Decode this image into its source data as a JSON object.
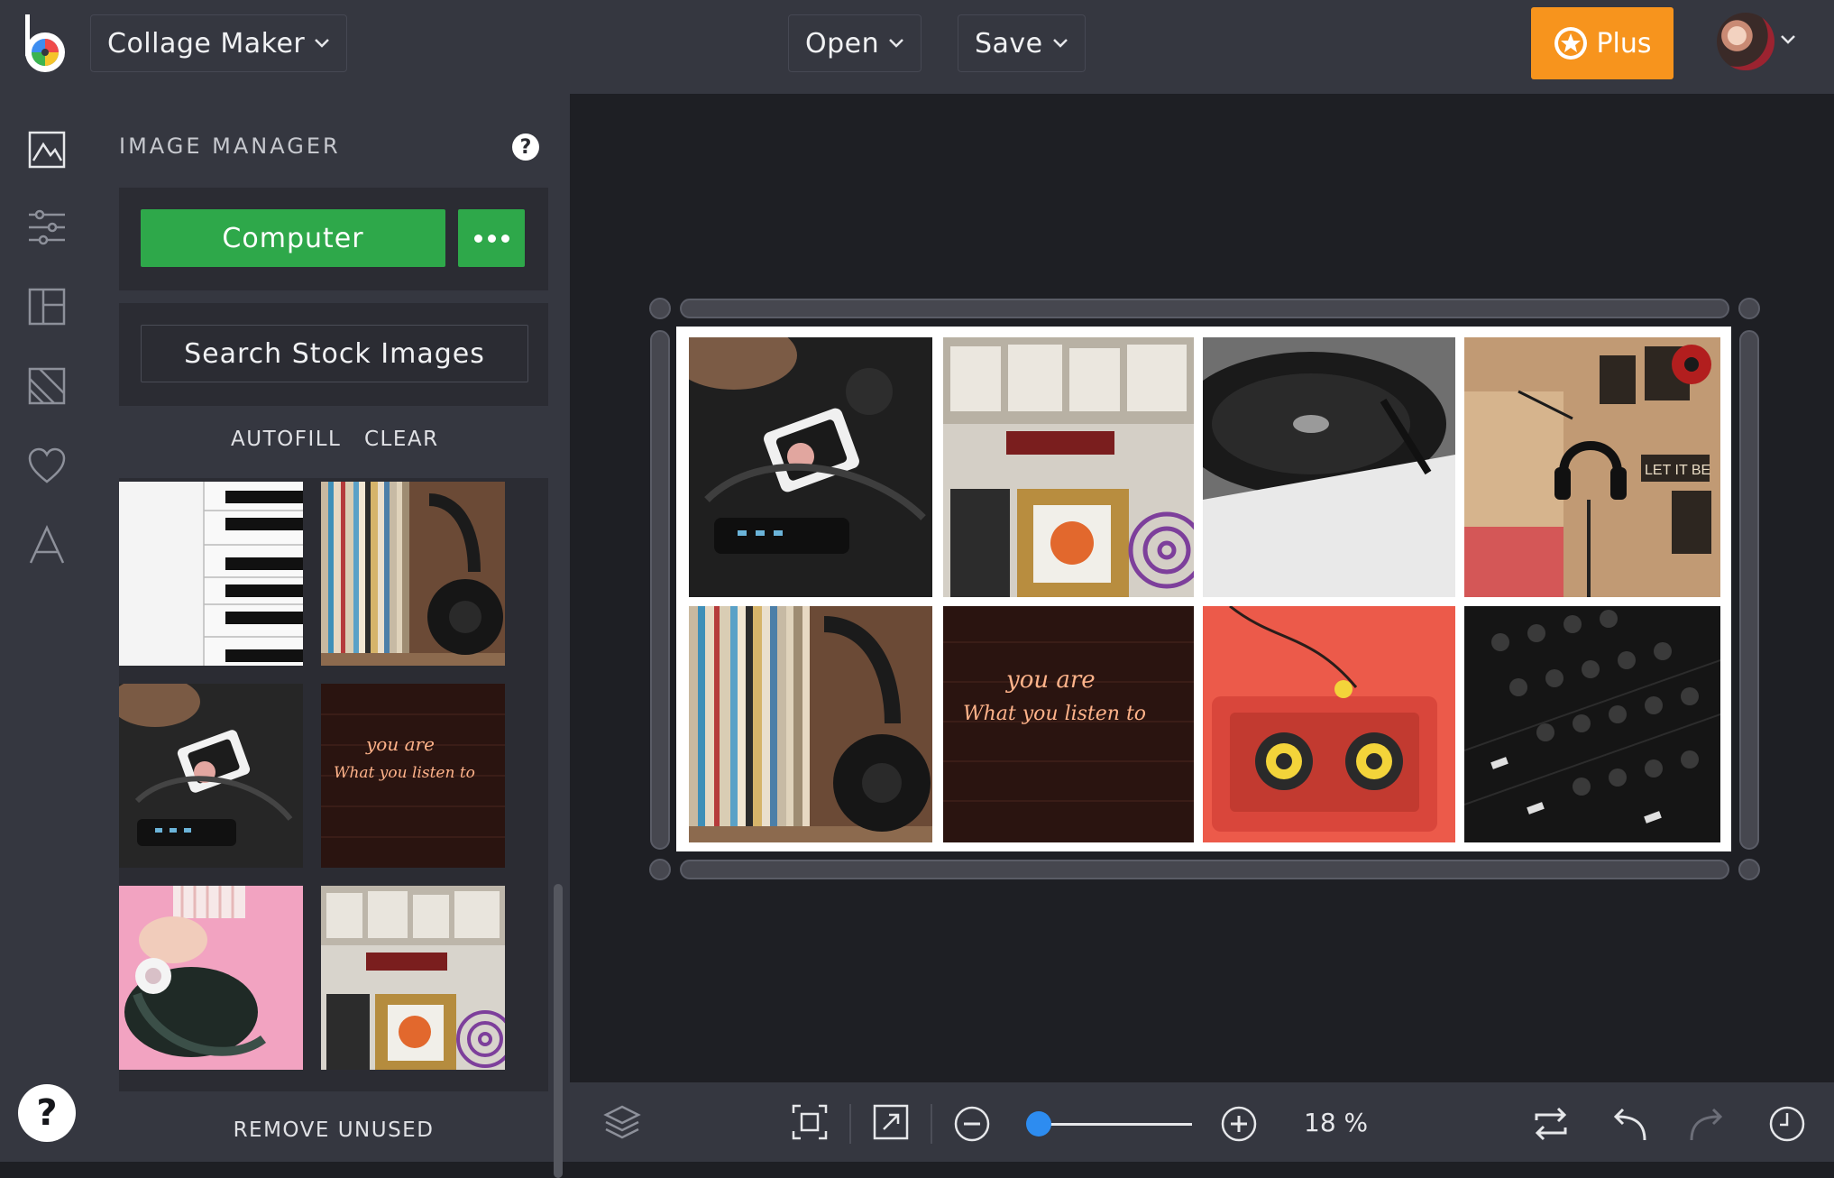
{
  "topbar": {
    "app_menu_label": "Collage Maker",
    "open_label": "Open",
    "save_label": "Save",
    "plus_label": "Plus"
  },
  "sidebar": {
    "rail_icons": [
      "image-icon",
      "sliders-icon",
      "layout-icon",
      "background-icon",
      "heart-icon",
      "text-icon"
    ],
    "help_label": "?"
  },
  "image_manager": {
    "title": "IMAGE MANAGER",
    "help_label": "?",
    "computer_label": "Computer",
    "search_stock_label": "Search Stock Images",
    "autofill_label": "AUTOFILL",
    "clear_label": "CLEAR",
    "remove_unused_label": "REMOVE UNUSED",
    "thumbnail_scene_texts": {
      "neon_line1": "you are",
      "neon_line2": "What you listen to"
    }
  },
  "collage": {
    "neon_line1": "you are",
    "neon_line2": "What you listen to",
    "records_poster": "LET IT BE"
  },
  "bottombar": {
    "zoom_percent_label": "18 %",
    "zoom_value": 18
  },
  "colors": {
    "topbar_bg": "#353740",
    "canvas_bg": "#1e1f24",
    "green_accent": "#2ea84a",
    "plus_orange": "#f7941d",
    "zoom_blue": "#2d8cf0"
  }
}
